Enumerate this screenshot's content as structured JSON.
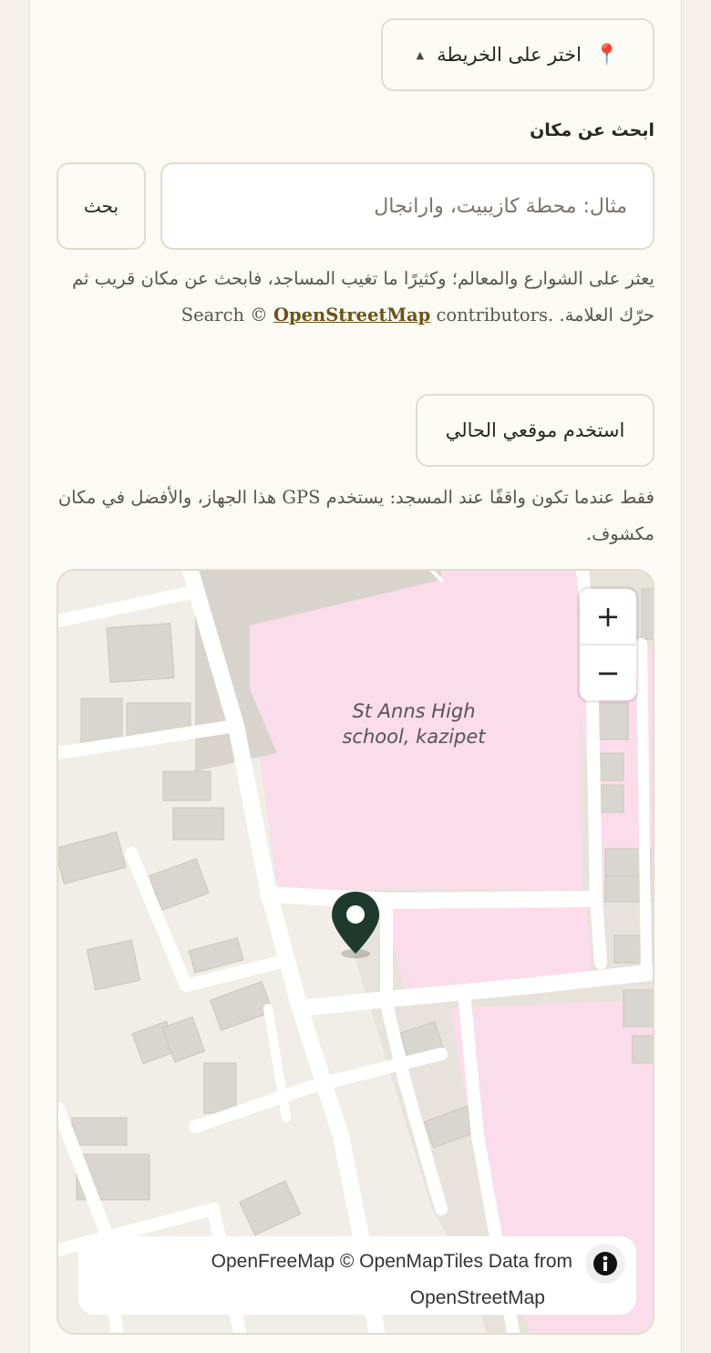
{
  "pick_on_map": {
    "label": "اختر على الخريطة",
    "icon": "map-pin-icon",
    "caret": "▲"
  },
  "search": {
    "label": "ابحث عن مكان",
    "placeholder": "مثال: محطة كازيبيت، وارانجال",
    "button": "بحث"
  },
  "help_search": {
    "before_link": "Search ©",
    "link": "OpenStreetMap",
    "after_link": "contributors.",
    "rest": "يعثر على الشوارع والمعالم؛ وكثيرًا ما تغيب المساجد، فابحث عن مكان قريب ثم حرّك العلامة."
  },
  "use_location": {
    "label": "استخدم موقعي الحالي"
  },
  "help_gps": {
    "text": "فقط عندما تكون واقفًا عند المسجد: يستخدم GPS هذا الجهاز، والأفضل في مكان مكشوف."
  },
  "map": {
    "zoom_in": "+",
    "zoom_out": "−",
    "place_label_line1": "St Anns High",
    "place_label_line2": "school, kazipet",
    "attribution_line1": "OpenFreeMap © OpenMapTiles Data from",
    "attribution_line2": "OpenStreetMap",
    "marker_color": "#1e3a2d",
    "school_color": "#fbdcea"
  }
}
